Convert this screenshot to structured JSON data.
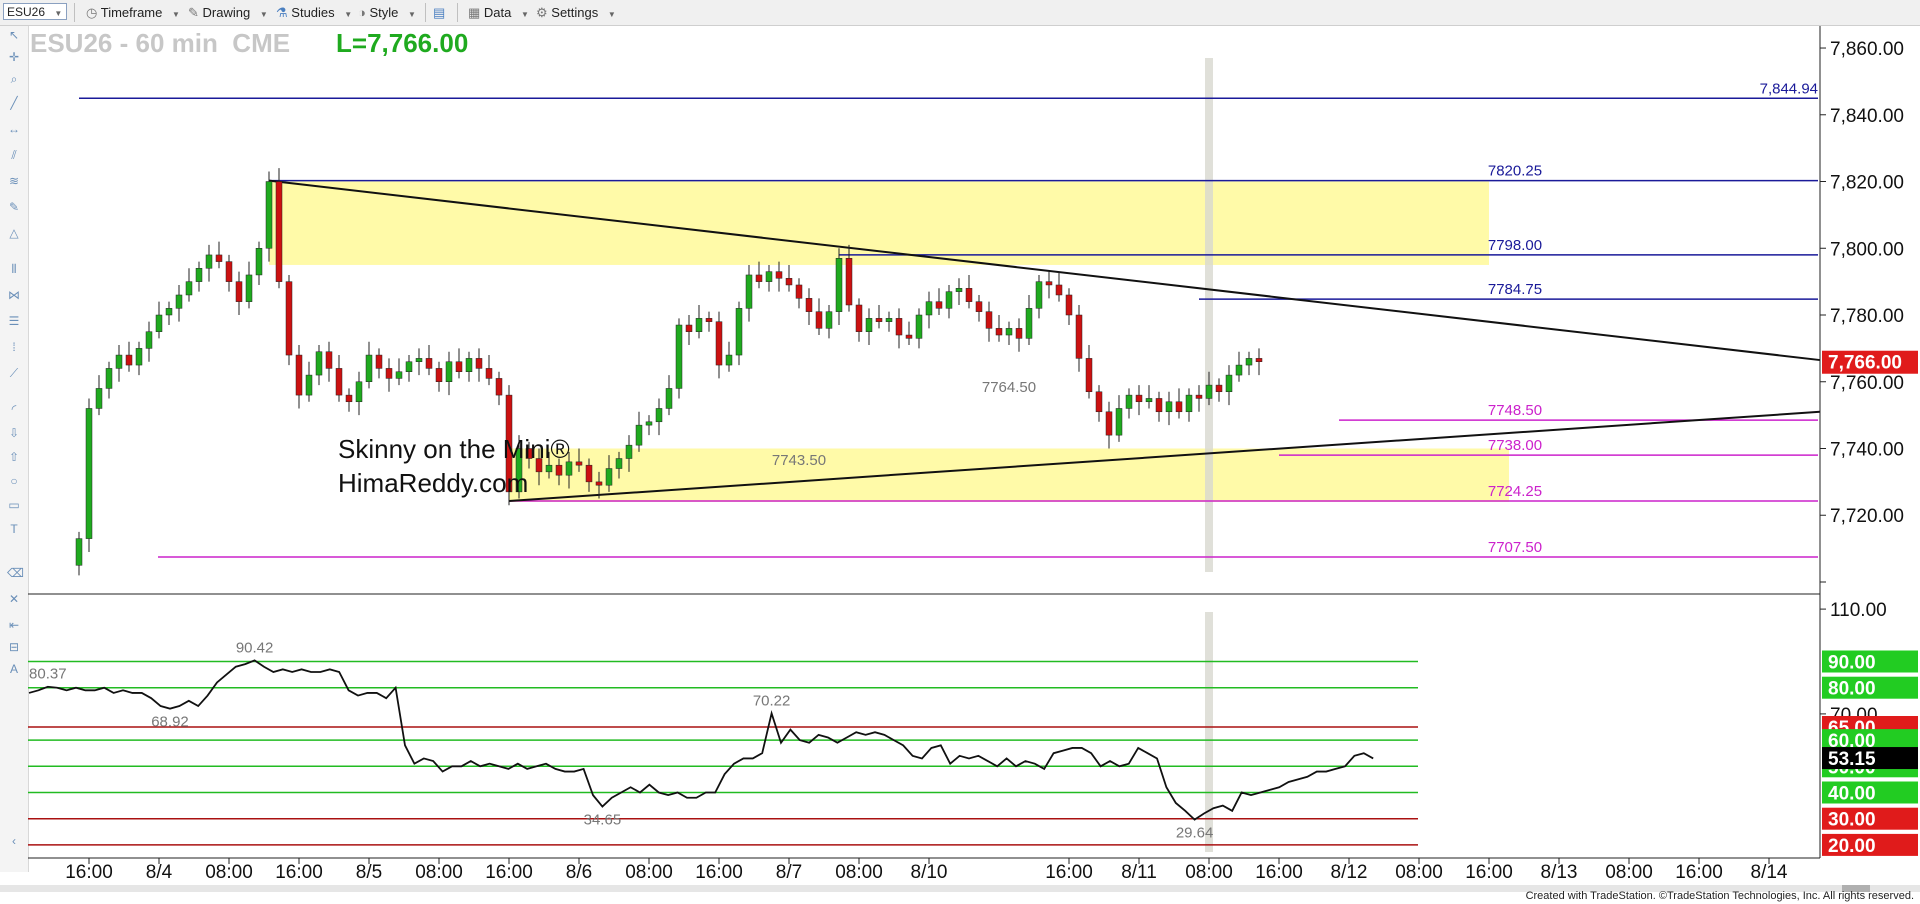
{
  "toolbar": {
    "symbol": "ESU26",
    "menus": [
      "Timeframe",
      "Drawing",
      "Studies",
      "Style",
      "Data",
      "Settings"
    ]
  },
  "chart_title": {
    "symbol_text": "ESU26 - 60 min  CME",
    "last_price": "L=7,766.00"
  },
  "watermark": {
    "line1": "Skinny on the Mini®",
    "line2": "HimaReddy.com"
  },
  "footer": "Created with TradeStation. ©TradeStation Technologies, Inc. All rights reserved.",
  "colors": {
    "up": "#1faa1f",
    "down": "#cc1111",
    "navy": "#1a1a99",
    "magenta": "#cc22cc",
    "zone": "#fffaa8",
    "green_line": "#22bb22",
    "red_line": "#aa1111",
    "last_bg": "#e01b1b"
  },
  "chart_data": {
    "type": "line",
    "x_axis_labels": [
      {
        "t": 1,
        "label": "16:00"
      },
      {
        "t": 8,
        "label": "8/4"
      },
      {
        "t": 15,
        "label": "08:00"
      },
      {
        "t": 22,
        "label": "16:00"
      },
      {
        "t": 29,
        "label": "8/5"
      },
      {
        "t": 36,
        "label": "08:00"
      },
      {
        "t": 43,
        "label": "16:00"
      },
      {
        "t": 50,
        "label": "8/6"
      },
      {
        "t": 57,
        "label": "08:00"
      },
      {
        "t": 64,
        "label": "16:00"
      },
      {
        "t": 71,
        "label": "8/7"
      },
      {
        "t": 78,
        "label": "08:00"
      },
      {
        "t": 85,
        "label": "8/10"
      },
      {
        "t": 99,
        "label": "16:00"
      },
      {
        "t": 106,
        "label": "8/11"
      },
      {
        "t": 113,
        "label": "08:00"
      },
      {
        "t": 120,
        "label": "16:00"
      },
      {
        "t": 127,
        "label": "8/12"
      },
      {
        "t": 134,
        "label": "08:00"
      },
      {
        "t": 141,
        "label": "16:00"
      },
      {
        "t": 148,
        "label": "8/13"
      },
      {
        "t": 155,
        "label": "08:00"
      },
      {
        "t": 162,
        "label": "16:00"
      },
      {
        "t": 169,
        "label": "8/14"
      }
    ],
    "price_panel": {
      "y_ticks": [
        "7,860.00",
        "7,840.00",
        "7,820.00",
        "7,800.00",
        "7,780.00",
        "7,760.00",
        "7,740.00",
        "7,720.00"
      ],
      "ylim": [
        7697,
        7866
      ],
      "last_price_label": "7,766.00",
      "close": [
        7713,
        7752,
        7758,
        7764,
        7768,
        7765,
        7770,
        7775,
        7780,
        7782,
        7786,
        7790,
        7794,
        7798,
        7796,
        7790,
        7784,
        7792,
        7800,
        7820,
        7790,
        7768,
        7756,
        7762,
        7769,
        7764,
        7756,
        7754,
        7760,
        7768,
        7764,
        7761,
        7763,
        7766,
        7767,
        7764,
        7760,
        7766,
        7763,
        7767,
        7764,
        7761,
        7756,
        7727,
        7740,
        7737,
        7733,
        7735,
        7732,
        7736,
        7735,
        7730,
        7729,
        7734,
        7737,
        7741,
        7747,
        7748,
        7752,
        7758,
        7777,
        7775,
        7779,
        7778,
        7765,
        7768,
        7782,
        7792,
        7790,
        7793,
        7791,
        7789,
        7785,
        7781,
        7776,
        7781,
        7797,
        7783,
        7775,
        7779,
        7778,
        7779,
        7774,
        7773,
        7780,
        7784,
        7782,
        7787,
        7788,
        7784,
        7781,
        7776,
        7774,
        7776,
        7773,
        7782,
        7790,
        7789,
        7786,
        7780,
        7767,
        7757,
        7751,
        7744,
        7752,
        7756,
        7754,
        7755,
        7751,
        7754,
        7751,
        7756,
        7755,
        7759,
        7757,
        7762,
        7765,
        7767,
        7766
      ],
      "hlines": [
        {
          "y": 7844.94,
          "label": "7,844.94",
          "color": "navy",
          "from": 0
        },
        {
          "y": 7820.25,
          "label": "7820.25",
          "color": "navy",
          "from": 19
        },
        {
          "y": 7798.0,
          "label": "7798.00",
          "color": "navy",
          "from": 76
        },
        {
          "y": 7784.75,
          "label": "7784.75",
          "color": "navy",
          "from": 112
        },
        {
          "y": 7748.5,
          "label": "7748.50",
          "color": "magenta",
          "from": 126
        },
        {
          "y": 7738.0,
          "label": "7738.00",
          "color": "magenta",
          "from": 120
        },
        {
          "y": 7724.25,
          "label": "7724.25",
          "color": "magenta",
          "from": 43
        },
        {
          "y": 7707.5,
          "label": "7707.50",
          "color": "magenta",
          "from": -8
        }
      ],
      "zones": [
        {
          "t0": 19,
          "t1": 141,
          "y0": 7795,
          "y1": 7820
        },
        {
          "t0": 43,
          "t1": 143,
          "y0": 7724,
          "y1": 7740
        }
      ],
      "trendlines": [
        {
          "t0": 19,
          "y0": 7820.25,
          "t1": 172,
          "y1": 7766.5
        },
        {
          "t0": 43,
          "y0": 7724.25,
          "t1": 172,
          "y1": 7751
        }
      ],
      "annotations": [
        {
          "t": 93,
          "y": 7760,
          "label": "7764.50"
        },
        {
          "t": 72,
          "y": 7738,
          "label": "7743.50"
        }
      ],
      "vertical_marker_t": 113
    },
    "indicator_panel": {
      "y_ticks": [
        "110.00",
        "70.00"
      ],
      "ylim": [
        15,
        115
      ],
      "levels": [
        {
          "y": 90,
          "label": "90.00",
          "color": "green"
        },
        {
          "y": 80,
          "label": "80.00",
          "color": "green"
        },
        {
          "y": 70,
          "label": "70.00",
          "color": "red"
        },
        {
          "y": 65,
          "label": "65.00",
          "color": "red"
        },
        {
          "y": 60,
          "label": "60.00",
          "color": "green"
        },
        {
          "y": 50,
          "label": "50.00",
          "color": "green"
        },
        {
          "y": 40,
          "label": "40.00",
          "color": "green"
        },
        {
          "y": 30,
          "label": "30.00",
          "color": "red"
        },
        {
          "y": 20,
          "label": "20.00",
          "color": "red"
        }
      ],
      "last_value_label": "53.15",
      "values": [
        78,
        79,
        80.37,
        80,
        79,
        80,
        79,
        79,
        80,
        78,
        79,
        78,
        78,
        76,
        73,
        72,
        73,
        75,
        73,
        77,
        82,
        85,
        88,
        89,
        90.42,
        88,
        86,
        87,
        86,
        87,
        86,
        86,
        87,
        86,
        79,
        77,
        78,
        78,
        76,
        80,
        58,
        51,
        53,
        52,
        48,
        50,
        50,
        52,
        50,
        51,
        50,
        49,
        51,
        49,
        50,
        51,
        49,
        48,
        48,
        49,
        39,
        34.65,
        38,
        40,
        42,
        40,
        43,
        40,
        39,
        40,
        38,
        38,
        40,
        40,
        47,
        51,
        53,
        53,
        55,
        70.22,
        59,
        64,
        60,
        59,
        62,
        61,
        59,
        61,
        63,
        62,
        63,
        62,
        60,
        58,
        54,
        53,
        57,
        58,
        51,
        54,
        53,
        54,
        52,
        50,
        53,
        50,
        52,
        51,
        49,
        55,
        56,
        57,
        57,
        55,
        50,
        52,
        50,
        51,
        57,
        55,
        53,
        42,
        36,
        33,
        29.64,
        32,
        34,
        35,
        33,
        40,
        39,
        40,
        41,
        42,
        44,
        45,
        46,
        48,
        48,
        49,
        50,
        54,
        55,
        53
      ],
      "annotations": [
        {
          "t": 24,
          "y": 90.42,
          "label": "90.42",
          "pos": "above"
        },
        {
          "t": 2,
          "y": 80.37,
          "label": "80.37",
          "pos": "above"
        },
        {
          "t": 16,
          "y": 72,
          "label": "68.92",
          "pos": "below"
        },
        {
          "t": 79,
          "y": 70.22,
          "label": "70.22",
          "pos": "above"
        },
        {
          "t": 61,
          "y": 34.65,
          "label": "34.65",
          "pos": "below"
        },
        {
          "t": 124,
          "y": 29.64,
          "label": "29.64",
          "pos": "below"
        }
      ]
    }
  }
}
